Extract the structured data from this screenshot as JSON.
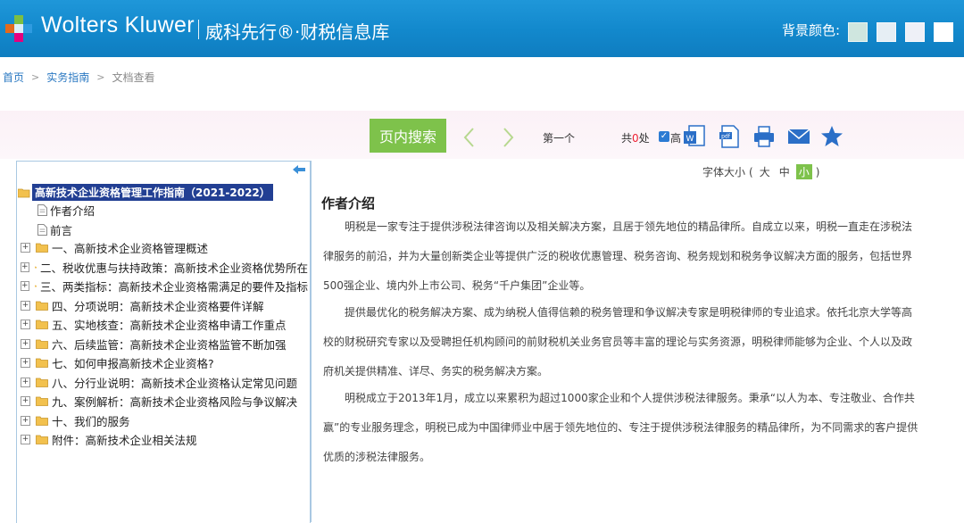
{
  "header": {
    "brand": "Wolters Kluwer",
    "brand_cn": "威科先行®·财税信息库",
    "bg_color_label": "背景颜色:",
    "bg_swatches": [
      "#cfe6df",
      "#e6eef4",
      "#eef0f7",
      "#ffffff"
    ]
  },
  "breadcrumb": {
    "home": "首页",
    "guide": "实务指南",
    "current": "文档查看"
  },
  "toolbar": {
    "search_label": "页内搜索",
    "first_label": "第一个",
    "count_prefix": "共",
    "count_value": "0",
    "count_suffix": "处",
    "highlight_label": "高"
  },
  "font_size": {
    "label": "字体大小",
    "open": "(",
    "close": ")",
    "large": "大",
    "medium": "中",
    "small": "小"
  },
  "tree": {
    "root": "高新技术企业资格管理工作指南（2021-2022）",
    "docs": [
      "作者介绍",
      "前言"
    ],
    "folders": [
      "一、高新技术企业资格管理概述",
      "二、税收优惠与扶持政策：高新技术企业资格优势所在",
      "三、两类指标：高新技术企业资格需满足的要件及指标",
      "四、分项说明：高新技术企业资格要件详解",
      "五、实地核查：高新技术企业资格申请工作重点",
      "六、后续监管：高新技术企业资格监管不断加强",
      "七、如何申报高新技术企业资格?",
      "八、分行业说明：高新技术企业资格认定常见问题",
      "九、案例解析：高新技术企业资格风险与争议解决",
      "十、我们的服务",
      "附件：高新技术企业相关法规"
    ]
  },
  "article": {
    "title": "作者介绍",
    "paragraphs": [
      "明税是一家专注于提供涉税法律咨询以及相关解决方案，且居于领先地位的精品律所。自成立以来，明税一直走在涉税法律服务的前沿，并为大量创新类企业等提供广泛的税收优惠管理、税务咨询、税务规划和税务争议解决方面的服务，包括世界500强企业、境内外上市公司、税务“千户集团”企业等。",
      "提供最优化的税务解决方案、成为纳税人值得信赖的税务管理和争议解决专家是明税律师的专业追求。依托北京大学等高校的财税研究专家以及受聘担任机构顾问的前财税机关业务官员等丰富的理论与实务资源，明税律师能够为企业、个人以及政府机关提供精准、详尽、务实的税务解决方案。",
      "明税成立于2013年1月，成立以来累积为超过1000家企业和个人提供涉税法律服务。秉承“以人为本、专注敬业、合作共赢”的专业服务理念，明税已成为中国律师业中居于领先地位的、专注于提供涉税法律服务的精品律所，为不同需求的客户提供优质的涉税法律服务。"
    ]
  },
  "colors": {
    "header_blue": "#1288cc",
    "accent_green": "#7ec24b",
    "tree_select": "#223f93",
    "link_blue": "#2a78c2"
  }
}
